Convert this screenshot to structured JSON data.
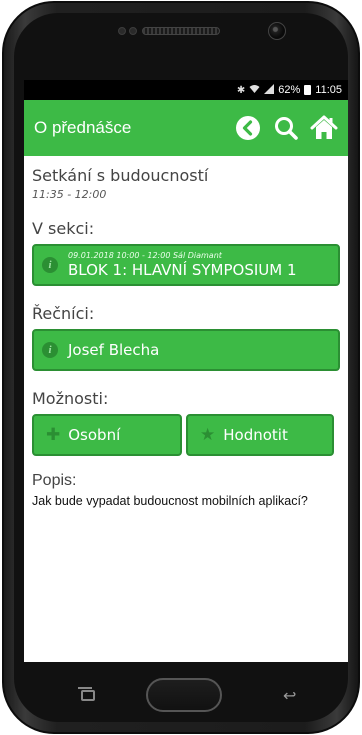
{
  "statusbar": {
    "bluetooth_icon": "bluetooth-icon",
    "wifi_icon": "wifi-icon",
    "signal_icon": "signal-icon",
    "battery_percent": "62%",
    "time": "11:05"
  },
  "appbar": {
    "title": "O přednášce",
    "back_icon": "back-circle-icon",
    "search_icon": "search-icon",
    "home_icon": "home-icon"
  },
  "talk": {
    "title": "Setkání s budoucností",
    "time": "11:35 - 12:00"
  },
  "section": {
    "label": "V sekci:",
    "block_meta": "09.01.2018  10:00 - 12:00  Sál Diamant",
    "block_name": "BLOK 1: HLAVNÍ SYMPOSIUM 1",
    "info_icon": "info-icon"
  },
  "speakers": {
    "label": "Řečníci:",
    "items": [
      {
        "name": "Josef Blecha",
        "icon": "info-icon"
      }
    ]
  },
  "options": {
    "label": "Možnosti:",
    "personal_label": "Osobní",
    "personal_icon": "plus-icon",
    "rate_label": "Hodnotit",
    "rate_icon": "star-icon"
  },
  "description": {
    "label": "Popis:",
    "text": "Jak bude vypadat budoucnost mobilních aplikací?"
  },
  "colors": {
    "accent": "#3dba46",
    "accent_dark": "#2b8f33"
  }
}
